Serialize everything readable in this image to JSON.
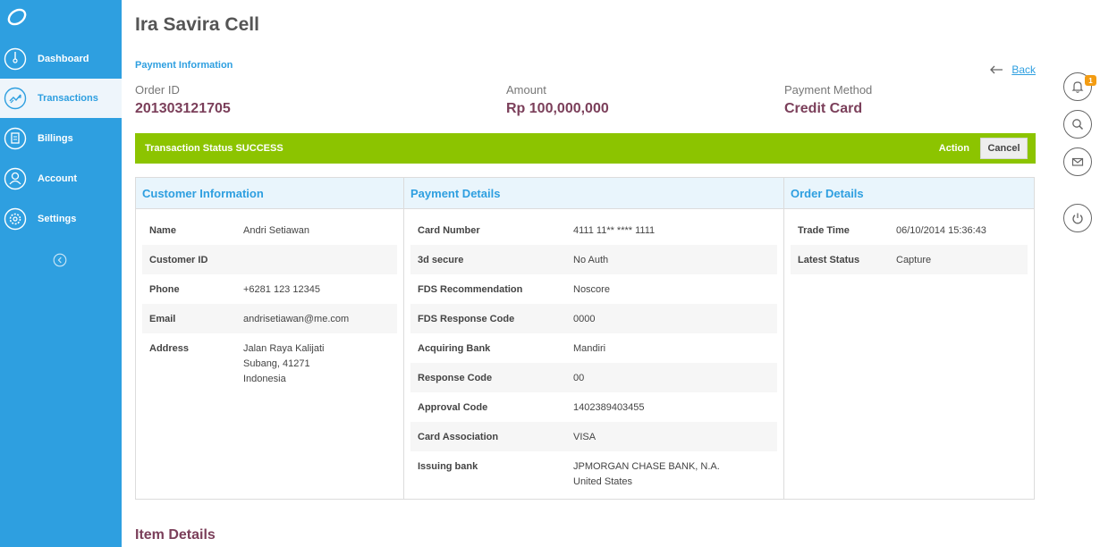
{
  "sidebar": {
    "items": [
      {
        "label": "Dashboard",
        "icon": "dashboard-icon"
      },
      {
        "label": "Transactions",
        "icon": "transactions-icon"
      },
      {
        "label": "Billings",
        "icon": "billings-icon"
      },
      {
        "label": "Account",
        "icon": "account-icon"
      },
      {
        "label": "Settings",
        "icon": "settings-icon"
      }
    ],
    "active": "Transactions"
  },
  "header": {
    "title": "Ira Savira Cell",
    "section": "Payment Information",
    "back_label": "Back"
  },
  "summary": {
    "order_id_label": "Order ID",
    "order_id": "201303121705",
    "amount_label": "Amount",
    "amount": "Rp 100,000,000",
    "method_label": "Payment Method",
    "method": "Credit Card"
  },
  "status": {
    "text": "Transaction Status SUCCESS",
    "action_label": "Action",
    "cancel_label": "Cancel"
  },
  "customer": {
    "title": "Customer Information",
    "rows": [
      {
        "k": "Name",
        "v": "Andri Setiawan"
      },
      {
        "k": "Customer ID",
        "v": ""
      },
      {
        "k": "Phone",
        "v": "+6281 123 12345"
      },
      {
        "k": "Email",
        "v": "andrisetiawan@me.com"
      },
      {
        "k": "Address",
        "v": "Jalan Raya Kalijati\nSubang, 41271\nIndonesia"
      }
    ]
  },
  "payment": {
    "title": "Payment Details",
    "rows": [
      {
        "k": "Card Number",
        "v": "4111 11** **** 1111"
      },
      {
        "k": "3d secure",
        "v": "No Auth"
      },
      {
        "k": "FDS Recommendation",
        "v": "Noscore"
      },
      {
        "k": "FDS Response Code",
        "v": "0000"
      },
      {
        "k": "Acquiring Bank",
        "v": "Mandiri"
      },
      {
        "k": "Response Code",
        "v": "00"
      },
      {
        "k": "Approval Code",
        "v": "1402389403455"
      },
      {
        "k": "Card Association",
        "v": "VISA"
      },
      {
        "k": "Issuing bank",
        "v": "JPMORGAN CHASE BANK, N.A.\nUnited States"
      }
    ]
  },
  "order": {
    "title": "Order Details",
    "rows": [
      {
        "k": "Trade Time",
        "v": "06/10/2014 15:36:43"
      },
      {
        "k": "Latest Status",
        "v": "Capture"
      }
    ]
  },
  "item_details_title": "Item Details",
  "rail": {
    "notification_count": "1",
    "icons": [
      "bell-icon",
      "search-icon",
      "mail-icon",
      "power-icon"
    ]
  },
  "colors": {
    "sidebar": "#2e9fe0",
    "status_bar": "#8cc400",
    "value_accent": "#7b3f5a"
  }
}
